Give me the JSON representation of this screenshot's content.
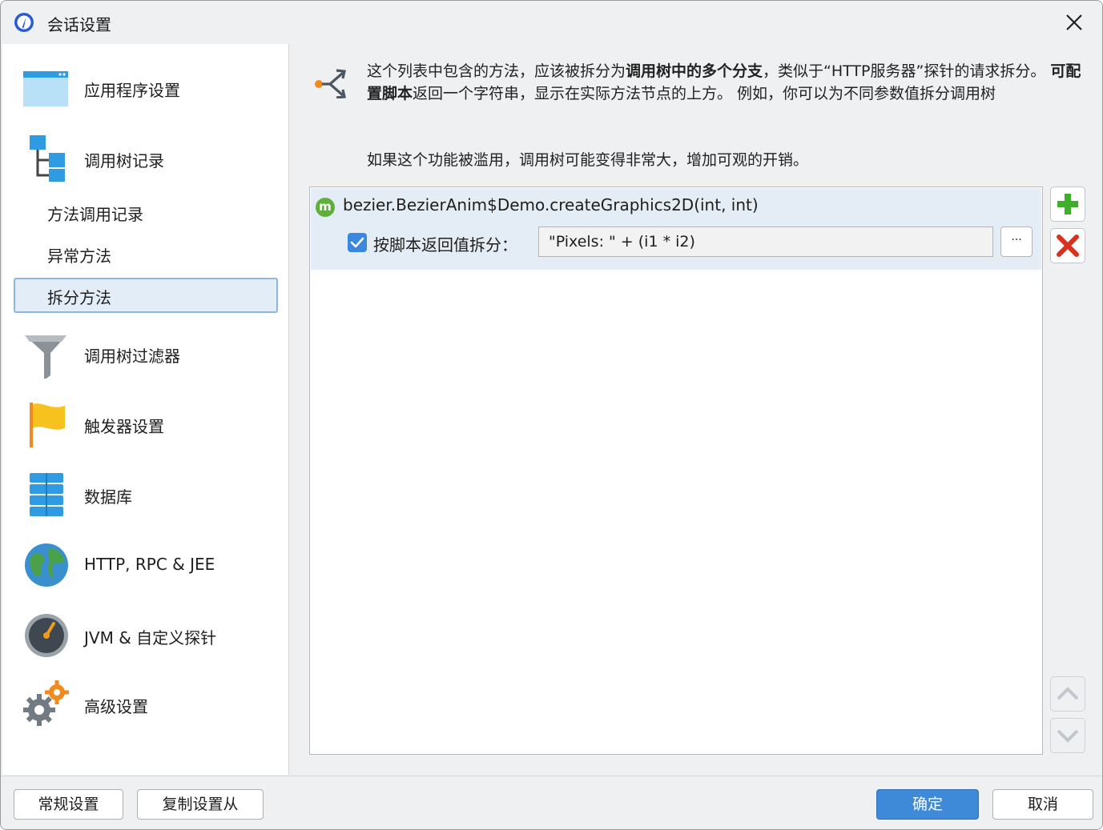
{
  "window": {
    "title": "会话设置"
  },
  "sidebar": {
    "items": [
      {
        "label": "应用程序设置",
        "icon": "application-settings-icon"
      },
      {
        "label": "调用树记录",
        "icon": "call-tree-icon"
      },
      {
        "label": "调用树过滤器",
        "icon": "funnel-icon"
      },
      {
        "label": "触发器设置",
        "icon": "flag-icon"
      },
      {
        "label": "数据库",
        "icon": "database-icon"
      },
      {
        "label": "HTTP, RPC & JEE",
        "icon": "globe-icon"
      },
      {
        "label": "JVM & 自定义探针",
        "icon": "gauge-icon"
      },
      {
        "label": "高级设置",
        "icon": "gears-icon"
      }
    ],
    "subitems": [
      {
        "label": "方法调用记录"
      },
      {
        "label": "异常方法"
      },
      {
        "label": "拆分方法",
        "selected": true
      }
    ]
  },
  "main": {
    "desc_part1": "这个列表中包含的方法，应该被拆分为",
    "desc_bold1": "调用树中的多个分支",
    "desc_part2": "，类似于“HTTP服务器”探针的请求拆分。 ",
    "desc_bold2": "可配置脚本",
    "desc_part3": "返回一个字符串，显示在实际方法节点的上方。 例如，你可以为不同参数值拆分调用树",
    "desc_line2": "如果这个功能被滥用，调用树可能变得非常大，增加可观的开销。",
    "list": [
      {
        "badge": "m",
        "method": "bezier.BezierAnim$Demo.createGraphics2D(int, int)",
        "checkbox_label": "按脚本返回值拆分：",
        "checked": true,
        "script": "\"Pixels: \" + (i1 * i2)",
        "dots_label": "···"
      }
    ]
  },
  "buttons": {
    "general": "常规设置",
    "copy_from": "复制设置从",
    "ok": "确定",
    "cancel": "取消"
  },
  "colors": {
    "accent": "#3f8ad8",
    "selection": "#e3edf8",
    "add_green": "#3fae29",
    "remove_red": "#d8321e"
  }
}
